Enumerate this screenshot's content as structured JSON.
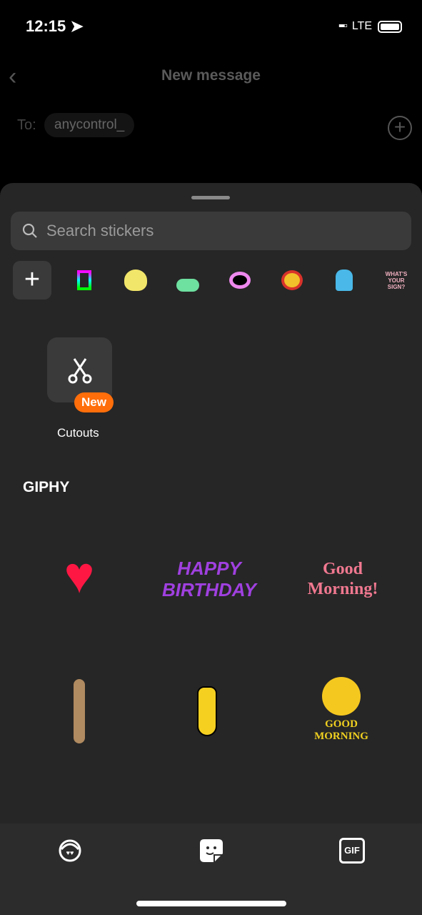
{
  "status": {
    "time": "12:15",
    "network": "LTE"
  },
  "header": {
    "title": "New message",
    "to_label": "To:",
    "recipient": "anycontrol_"
  },
  "sheet": {
    "search_placeholder": "Search stickers",
    "packs": [
      "giphy-icon",
      "yellow-skull",
      "green-cloud",
      "pink-lips",
      "wow-badge",
      "blue-creature",
      "whats-your-sign"
    ],
    "pack_sign_text": "WHAT'S YOUR SIGN?",
    "cutouts": {
      "label": "Cutouts",
      "badge": "New",
      "badge_color": "#ff6e0a"
    },
    "section_title": "GIPHY",
    "stickers": [
      {
        "name": "red-heart"
      },
      {
        "name": "happy-birthday",
        "text": "HAPPY BIRTHDAY"
      },
      {
        "name": "good-morning-hearts",
        "text": "Good Morning!"
      },
      {
        "name": "dancing-dog"
      },
      {
        "name": "dancing-banana"
      },
      {
        "name": "good-morning-sun",
        "text": "GOOD MORNING"
      }
    ]
  },
  "tabs": [
    {
      "icon": "avatar-icon"
    },
    {
      "icon": "sticker-icon",
      "active": true
    },
    {
      "icon": "gif-icon",
      "label": "GIF"
    }
  ]
}
